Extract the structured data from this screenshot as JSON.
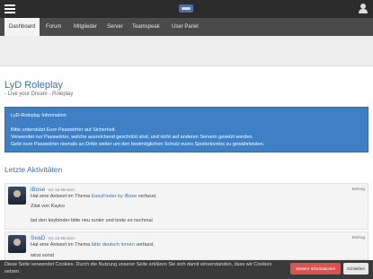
{
  "header": {
    "menu_icon": "hamburger-menu-icon",
    "logo": "site-logo",
    "user_icon": "user-icon"
  },
  "nav": {
    "items": [
      {
        "label": "Dashboard",
        "active": true
      },
      {
        "label": "Forum"
      },
      {
        "label": "Mitglieder"
      },
      {
        "label": "Server"
      },
      {
        "label": "Teamspeak"
      },
      {
        "label": "User Panel"
      }
    ]
  },
  "page": {
    "title": "LyD Roleplay",
    "subtitle": "- Live your Dream - Roleplay"
  },
  "info": {
    "heading": "LyD-Roleplay Information",
    "lines": [
      "Bitte unterstützt Eure Passwörter auf Sicherheit.",
      "Verwendet nur Passwörter, welche ausreichend geschützt sind, und nicht auf anderen Servern gesetzt werden.",
      "Gebt eure Passwörter niemals an Dritte weiter um den bestmöglichen Schutz eures Spielerkontos zu gewährleisten."
    ]
  },
  "activity": {
    "title": "Letzte Aktivitäten",
    "entries": [
      {
        "user": "iBose",
        "time": "Vor 15 Minuten",
        "action_prefix": "Hat eine Antwort im Thema",
        "topic": "EasyFinder by iBose",
        "action_suffix": "verfasst.",
        "quote": "Zitat von Kayko",
        "text": "lad den keybinder bitte neu runter und teste es nochmal",
        "tag": "Beitrag"
      },
      {
        "user": "SeaD",
        "time": "Vor 24 Minuten",
        "action_prefix": "Hat eine Antwort im Thema",
        "topic": "bitte deutsch lernen",
        "action_suffix": "verfasst.",
        "text": "wirst sonst",
        "tag": "Beitrag"
      }
    ]
  },
  "cookie": {
    "text": "Diese Seite verwendet Cookies. Durch die Nutzung unserer Seite erklären Sie sich damit einverstanden, dass wir Cookies setzen.",
    "more_label": "Weitere Informationen",
    "close_label": "Schließen"
  },
  "colors": {
    "topbar": "#2c2c2c",
    "navbar": "#4a4a4a",
    "accent": "#3d73ab",
    "info_box": "#3f7fc3",
    "cookie_more": "#d9534f"
  }
}
